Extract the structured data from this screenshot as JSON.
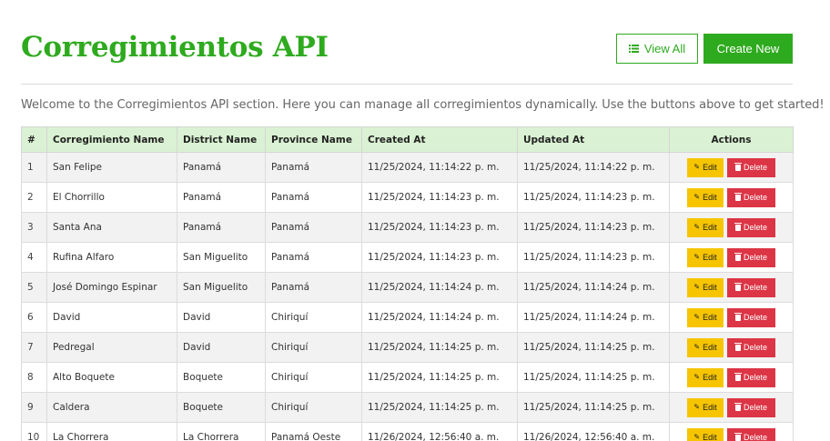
{
  "header": {
    "title": "Corregimientos API",
    "view_all_label": "View All",
    "create_new_label": "Create New"
  },
  "welcome": "Welcome to the Corregimientos API section. Here you can manage all corregimientos dynamically. Use the buttons above to get started!",
  "table": {
    "columns": [
      "#",
      "Corregimiento Name",
      "District Name",
      "Province Name",
      "Created At",
      "Updated At",
      "Actions"
    ],
    "edit_label": "Edit",
    "delete_label": "Delete",
    "rows": [
      {
        "id": "1",
        "name": "San Felipe",
        "district": "Panamá",
        "province": "Panamá",
        "created": "11/25/2024, 11:14:22 p. m.",
        "updated": "11/25/2024, 11:14:22 p. m."
      },
      {
        "id": "2",
        "name": "El Chorrillo",
        "district": "Panamá",
        "province": "Panamá",
        "created": "11/25/2024, 11:14:23 p. m.",
        "updated": "11/25/2024, 11:14:23 p. m."
      },
      {
        "id": "3",
        "name": "Santa Ana",
        "district": "Panamá",
        "province": "Panamá",
        "created": "11/25/2024, 11:14:23 p. m.",
        "updated": "11/25/2024, 11:14:23 p. m."
      },
      {
        "id": "4",
        "name": "Rufina Alfaro",
        "district": "San Miguelito",
        "province": "Panamá",
        "created": "11/25/2024, 11:14:23 p. m.",
        "updated": "11/25/2024, 11:14:23 p. m."
      },
      {
        "id": "5",
        "name": "José Domingo Espinar",
        "district": "San Miguelito",
        "province": "Panamá",
        "created": "11/25/2024, 11:14:24 p. m.",
        "updated": "11/25/2024, 11:14:24 p. m."
      },
      {
        "id": "6",
        "name": "David",
        "district": "David",
        "province": "Chiriquí",
        "created": "11/25/2024, 11:14:24 p. m.",
        "updated": "11/25/2024, 11:14:24 p. m."
      },
      {
        "id": "7",
        "name": "Pedregal",
        "district": "David",
        "province": "Chiriquí",
        "created": "11/25/2024, 11:14:25 p. m.",
        "updated": "11/25/2024, 11:14:25 p. m."
      },
      {
        "id": "8",
        "name": "Alto Boquete",
        "district": "Boquete",
        "province": "Chiriquí",
        "created": "11/25/2024, 11:14:25 p. m.",
        "updated": "11/25/2024, 11:14:25 p. m."
      },
      {
        "id": "9",
        "name": "Caldera",
        "district": "Boquete",
        "province": "Chiriquí",
        "created": "11/25/2024, 11:14:25 p. m.",
        "updated": "11/25/2024, 11:14:25 p. m."
      },
      {
        "id": "10",
        "name": "La Chorrera",
        "district": "La Chorrera",
        "province": "Panamá Oeste",
        "created": "11/26/2024, 12:56:40 a. m.",
        "updated": "11/26/2024, 12:56:40 a. m."
      }
    ]
  },
  "colors": {
    "accent": "#2eaa1e",
    "header_row": "#daf2d3",
    "edit": "#f6c500",
    "delete": "#dc3545"
  },
  "icons": {
    "view_all": "list-icon",
    "edit": "pencil-icon",
    "delete": "trash-icon"
  }
}
